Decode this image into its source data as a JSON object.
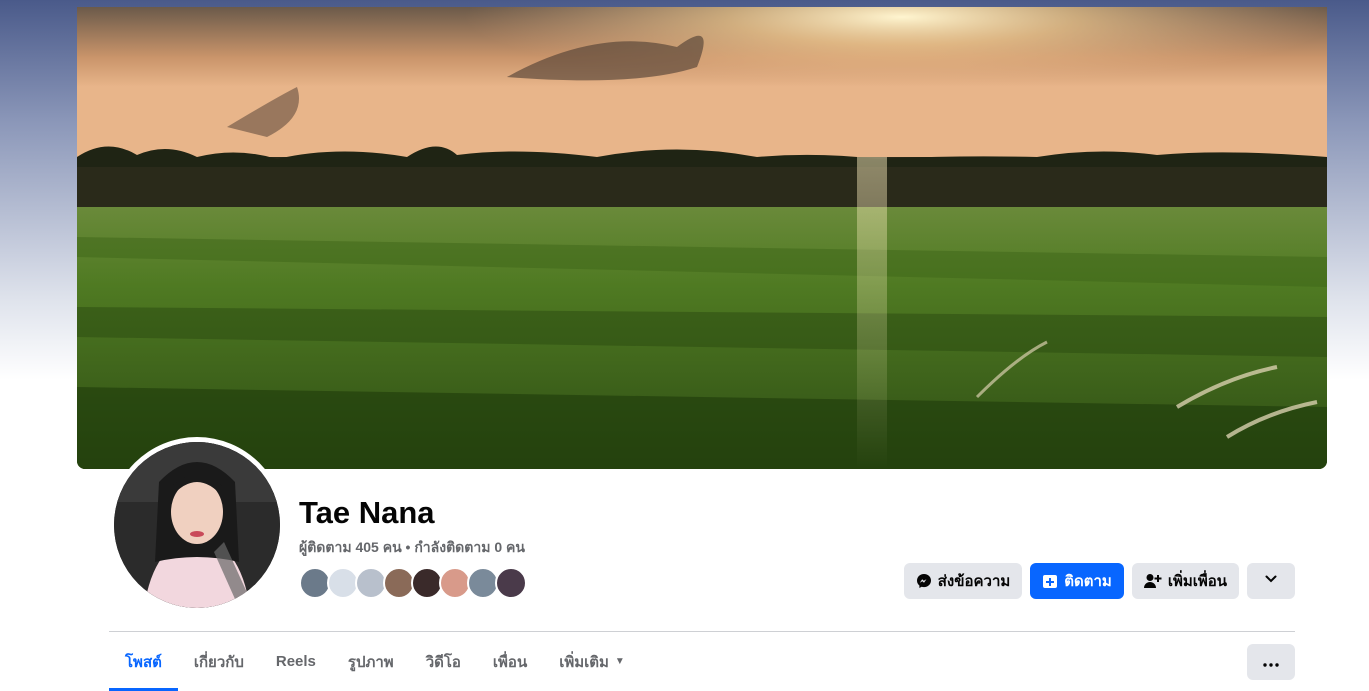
{
  "profile": {
    "name": "Tae Nana",
    "follow_stats": "ผู้ติดตาม 405 คน • กำลังติดตาม 0 คน",
    "friend_avatar_count": 8
  },
  "actions": {
    "message_label": "ส่งข้อความ",
    "message_icon": "messenger-icon",
    "follow_label": "ติดตาม",
    "follow_icon": "follow-plus-icon",
    "add_friend_label": "เพิ่มเพื่อน",
    "add_friend_icon": "add-friend-icon",
    "dropdown_icon": "chevron-down-icon"
  },
  "tabs": [
    {
      "label": "โพสต์",
      "active": true
    },
    {
      "label": "เกี่ยวกับ",
      "active": false
    },
    {
      "label": "Reels",
      "active": false
    },
    {
      "label": "รูปภาพ",
      "active": false
    },
    {
      "label": "วิดีโอ",
      "active": false
    },
    {
      "label": "เพื่อน",
      "active": false
    },
    {
      "label": "เพิ่มเติม",
      "active": false
    }
  ],
  "more_options_icon": "ellipsis-icon",
  "colors": {
    "accent": "#0866ff",
    "button_bg": "#e4e6eb",
    "secondary_text": "#65676b"
  }
}
